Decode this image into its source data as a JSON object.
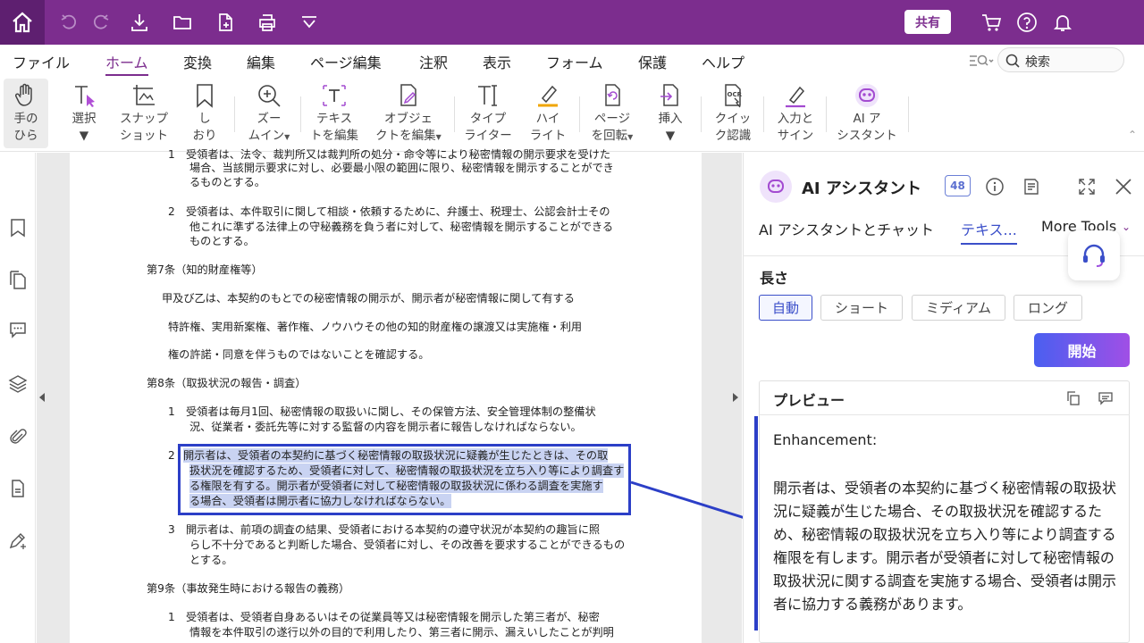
{
  "titlebar": {
    "share": "共有"
  },
  "menu": {
    "items": [
      "ファイル",
      "ホーム",
      "変換",
      "編集",
      "ページ編集",
      "注釈",
      "表示",
      "フォーム",
      "保護",
      "ヘルプ"
    ],
    "search_label": "検索"
  },
  "ribbon": {
    "tools": [
      {
        "l1": "手の",
        "l2": "ひら"
      },
      {
        "l1": "選択",
        "l2": ""
      },
      {
        "l1": "スナップ",
        "l2": "ショット"
      },
      {
        "l1": "し",
        "l2": "おり"
      },
      {
        "l1": "ズー",
        "l2": "ムイン"
      },
      {
        "l1": "テキス",
        "l2": "トを編集"
      },
      {
        "l1": "オブジェ",
        "l2": "クトを編集"
      },
      {
        "l1": "タイプ",
        "l2": "ライター"
      },
      {
        "l1": "ハイ",
        "l2": "ライト"
      },
      {
        "l1": "ページ",
        "l2": "を回転"
      },
      {
        "l1": "挿入",
        "l2": ""
      },
      {
        "l1": "クイッ",
        "l2": "ク認識"
      },
      {
        "l1": "入力と",
        "l2": "サイン"
      },
      {
        "l1": "AI ア",
        "l2": "シスタント"
      }
    ]
  },
  "document": {
    "lines": [
      "1　受領者は、法令、裁判所又は裁判所の処分・命令等により秘密情報の開示要求を受けた",
      "場合、当該開示要求に対し、必要最小限の範囲に限り、秘密情報を開示することができ",
      "るものとする。",
      "2　受領者は、本件取引に関して相談・依頼するために、弁護士、税理士、公認会計士その",
      "他これに準ずる法律上の守秘義務を負う者に対して、秘密情報を開示することができる",
      "ものとする。",
      "第7条（知的財産権等）",
      "甲及び乙は、本契約のもとでの秘密情報の開示が、開示者が秘密情報に関して有する",
      "特許権、実用新案権、著作権、ノウハウその他の知的財産権の譲渡又は実施権・利用",
      "権の許諾・同意を伴うものではないことを確認する。",
      "第8条（取扱状況の報告・調査）",
      "1　受領者は毎月1回、秘密情報の取扱いに関し、その保管方法、安全管理体制の整備状",
      "況、従業者・委託先等に対する監督の内容を開示者に報告しなければならない。",
      "2",
      "開示者は、受領者の本契約に基づく秘密情報の取扱状況に疑義が生じたときは、その取",
      "扱状況を確認するため、受領者に対して、秘密情報の取扱状況を立ち入り等により調査す",
      "る権限を有する。開示者が受領者に対して秘密情報の取扱状況に係わる調査を実施す",
      "る場合、受領者は開示者に協力しなければならない。",
      "3　開示者は、前項の調査の結果、受領者における本契約の遵守状況が本契約の趣旨に照",
      "らし不十分であると判断した場合、受領者に対し、その改善を要求することができるもの",
      "とする。",
      "第9条（事故発生時における報告の義務）",
      "1　受領者は、受領者自身あるいはその従業員等又は秘密情報を開示した第三者が、秘密",
      "情報を本件取引の遂行以外の目的で利用したり、第三者に開示、漏えいしたことが判明"
    ]
  },
  "panel": {
    "title": "AI アシスタント",
    "credits": "48",
    "tabs": [
      "AI アシスタントとチャット",
      "テキス...",
      "More Tools"
    ],
    "length_label": "長さ",
    "length_options": [
      "自動",
      "ショート",
      "ミディアム",
      "ロング"
    ],
    "start": "開始",
    "preview_title": "プレビュー",
    "preview_head": "Enhancement:",
    "preview_body": "開示者は、受領者の本契約に基づく秘密情報の取扱状況に疑義が生じた場合、その取扱状況を確認するため、秘密情報の取扱状況を立ち入り等により調査する権限を有します。開示者が受領者に対して秘密情報の取扱状況に関する調査を実施する場合、受領者は開示者に協力する義務があります。"
  },
  "colors": {
    "brand": "#7c2d8e",
    "accent": "#3b4fc9"
  }
}
